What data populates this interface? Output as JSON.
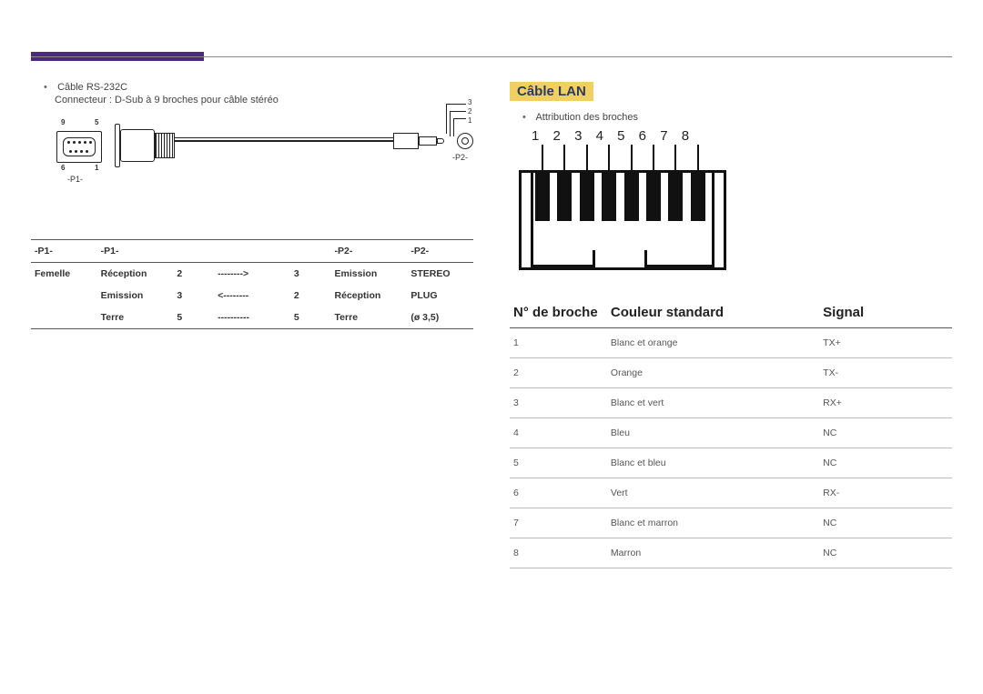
{
  "left": {
    "bullet": "Câble RS-232C",
    "subline": "Connecteur : D-Sub à 9 broches pour câble stéréo",
    "diagram": {
      "p1_label": "-P1-",
      "p2_label": "-P2-",
      "pin9": "9",
      "pin5": "5",
      "pin6": "6",
      "pin1": "1",
      "jack3": "3",
      "jack2": "2",
      "jack1": "1"
    },
    "table": {
      "headers": [
        "-P1-",
        "-P1-",
        "",
        "",
        "",
        "-P2-",
        "-P2-"
      ],
      "rows": [
        [
          "Femelle",
          "Réception",
          "2",
          "-------->",
          "3",
          "Emission",
          "STEREO"
        ],
        [
          "",
          "Emission",
          "3",
          "<--------",
          "2",
          "Réception",
          "PLUG"
        ],
        [
          "",
          "Terre",
          "5",
          "----------",
          "5",
          "Terre",
          "(ø 3,5)"
        ]
      ]
    }
  },
  "right": {
    "heading": "Câble LAN",
    "bullet": "Attribution des broches",
    "pin_numbers": [
      "1",
      "2",
      "3",
      "4",
      "5",
      "6",
      "7",
      "8"
    ],
    "table": {
      "headers": [
        "N° de broche",
        "Couleur standard",
        "Signal"
      ],
      "rows": [
        [
          "1",
          "Blanc et orange",
          "TX+"
        ],
        [
          "2",
          "Orange",
          "TX-"
        ],
        [
          "3",
          "Blanc et vert",
          "RX+"
        ],
        [
          "4",
          "Bleu",
          "NC"
        ],
        [
          "5",
          "Blanc et bleu",
          "NC"
        ],
        [
          "6",
          "Vert",
          "RX-"
        ],
        [
          "7",
          "Blanc et marron",
          "NC"
        ],
        [
          "8",
          "Marron",
          "NC"
        ]
      ]
    }
  }
}
